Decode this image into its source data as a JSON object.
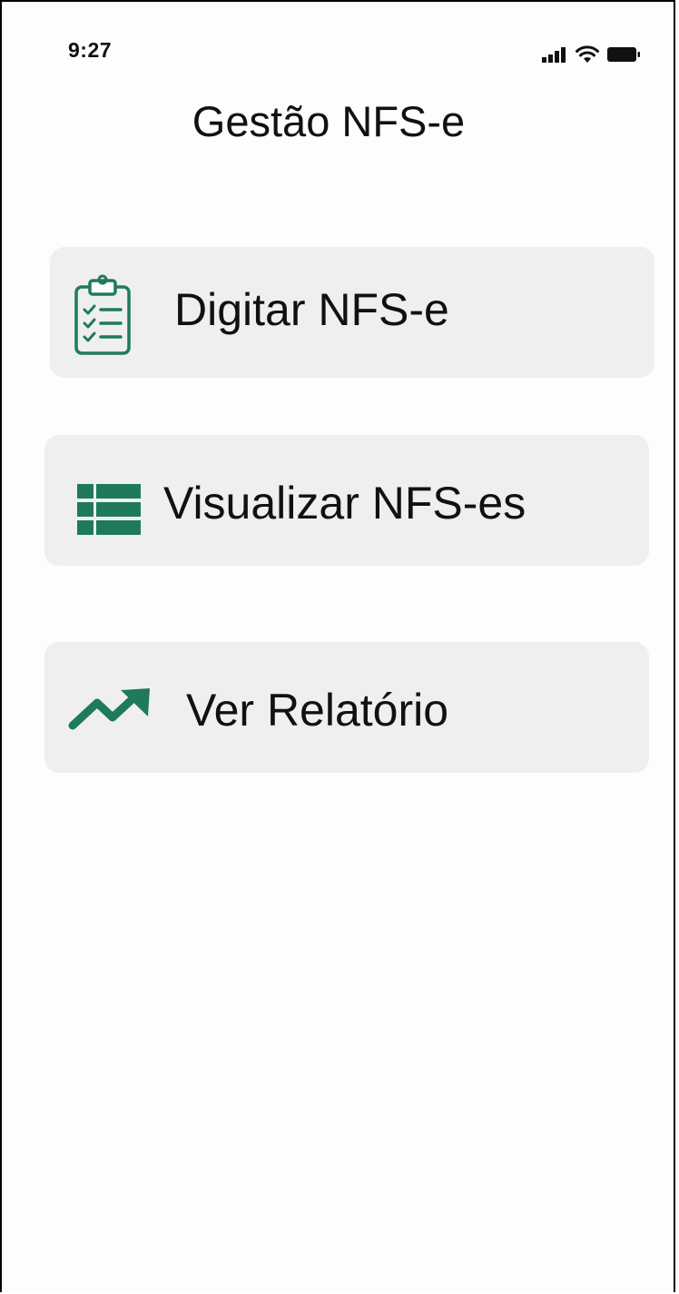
{
  "status_bar": {
    "time": "9:27",
    "icons": [
      "signal-icon",
      "wifi-icon",
      "battery-icon"
    ]
  },
  "header": {
    "title": "Gestão NFS-e"
  },
  "menu": {
    "items": [
      {
        "label": "Digitar NFS-e",
        "icon": "clipboard-checklist-icon"
      },
      {
        "label": "Visualizar NFS-es",
        "icon": "table-list-icon"
      },
      {
        "label": "Ver Relatório",
        "icon": "trending-up-icon"
      }
    ]
  },
  "colors": {
    "accent": "#1f7a5c",
    "button_bg": "#efefef",
    "text": "#111111",
    "background": "#fdfdfd"
  }
}
